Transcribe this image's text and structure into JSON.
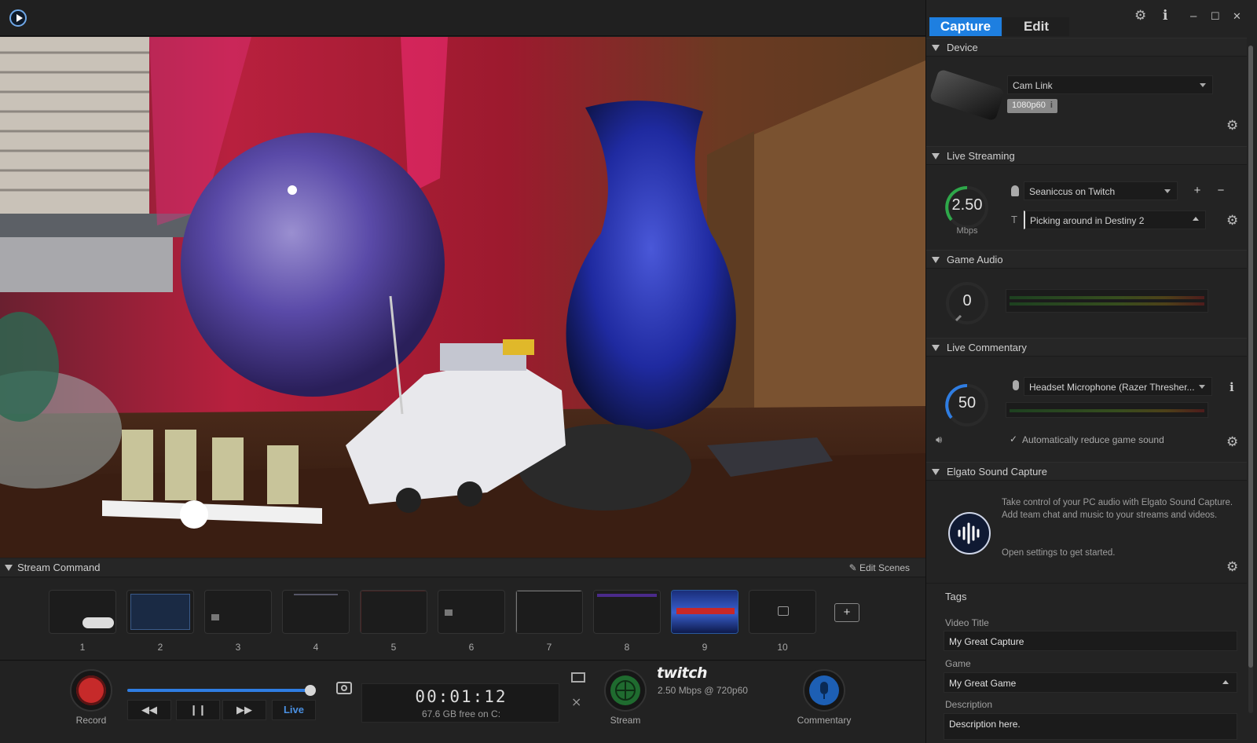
{
  "panel": {
    "tabs": [
      "Capture",
      "Edit"
    ],
    "device": {
      "section_title": "Device",
      "selected_device": "Cam Link",
      "format_badge": "1080p60",
      "format_info_icon": "i"
    },
    "live_streaming": {
      "section_title": "Live Streaming",
      "bitrate_value": "2.50",
      "bitrate_unit": "Mbps",
      "account": "Seaniccus on Twitch",
      "stream_title": "Picking around in Destiny 2",
      "add_label": "+",
      "remove_label": "−"
    },
    "game_audio": {
      "section_title": "Game Audio",
      "volume": "0"
    },
    "live_commentary": {
      "section_title": "Live Commentary",
      "volume": "50",
      "microphone": "Headset Microphone (Razer Thresher...",
      "auto_reduce_label": "Automatically reduce game sound",
      "info_icon": "i"
    },
    "sound_capture": {
      "section_title": "Elgato Sound Capture",
      "description": "Take control of your PC audio with Elgato Sound Capture. Add team chat and music to your streams and videos.",
      "hint": "Open settings to get started."
    },
    "tags": {
      "section_title": "Tags",
      "video_title_label": "Video Title",
      "video_title_value": "My Great Capture",
      "game_label": "Game",
      "game_value": "My Great Game",
      "description_label": "Description",
      "description_value": "Description here."
    },
    "window_controls": {
      "minimize": "–",
      "maximize": "☐",
      "close": "✕"
    }
  },
  "stream_command": {
    "title": "Stream Command",
    "edit_scenes_label": "Edit Scenes",
    "scenes": [
      "1",
      "2",
      "3",
      "4",
      "5",
      "6",
      "7",
      "8",
      "9",
      "10"
    ],
    "add_scene_label": "+"
  },
  "controls": {
    "record_label": "Record",
    "playback_progress": 0.97,
    "live_label": "Live",
    "rewind_label": "◀◀",
    "pause_label": "❙❙",
    "forward_label": "▶▶",
    "timer": "00:01:12",
    "disk_free": "67.6 GB free on C:",
    "service_logo": "twitch",
    "stream_stats": "2.50 Mbps @ 720p60",
    "stream_label": "Stream",
    "commentary_label": "Commentary"
  },
  "colors": {
    "accent": "#1e7fe0",
    "record": "#c62a2a",
    "stream": "#1f6b2f",
    "commentary": "#1d5fb4"
  }
}
